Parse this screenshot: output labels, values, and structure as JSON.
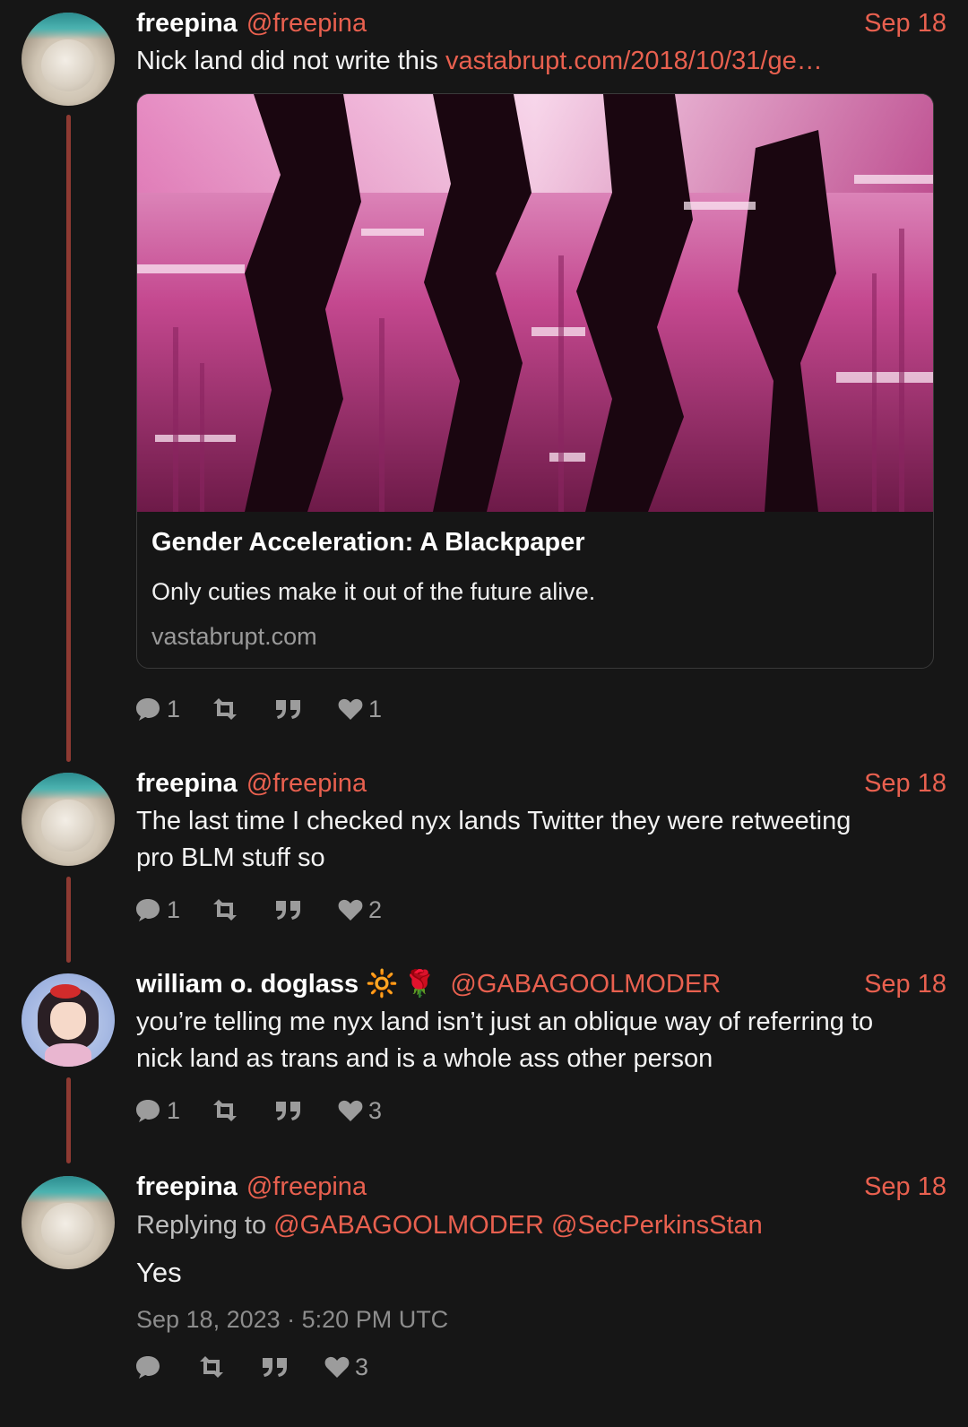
{
  "tweets": [
    {
      "name": "freepina",
      "handle": "@freepina",
      "date": "Sep 18",
      "text_prefix": "Nick land did not write this ",
      "link": "vastabrupt.com/2018/10/31/ge…",
      "card": {
        "title": "Gender Acceleration: A Blackpaper",
        "description": "Only cuties make it out of the future alive.",
        "domain": "vastabrupt.com"
      },
      "actions": {
        "replies": "1",
        "retweets": "",
        "quotes": "",
        "likes": "1"
      }
    },
    {
      "name": "freepina",
      "handle": "@freepina",
      "date": "Sep 18",
      "text_line1": "The last time I checked nyx lands Twitter they were retweeting",
      "text_line2": "pro BLM stuff so",
      "actions": {
        "replies": "1",
        "retweets": "",
        "quotes": "",
        "likes": "2"
      }
    },
    {
      "name": "william o. doglass",
      "name_emoji1": "🔆",
      "name_emoji2": "🌹",
      "handle": "@GABAGOOLMODER",
      "date": "Sep 18",
      "text_line1": "you’re telling me nyx land isn’t just an oblique way of referring to",
      "text_line2": "nick land as trans and is a whole ass other person",
      "actions": {
        "replies": "1",
        "retweets": "",
        "quotes": "",
        "likes": "3"
      }
    },
    {
      "name": "freepina",
      "handle": "@freepina",
      "date": "Sep 18",
      "replying_label": "Replying to",
      "replying_to1": "@GABAGOOLMODER",
      "replying_to2": "@SecPerkinsStan",
      "text": "Yes",
      "timestamp": "Sep 18, 2023 · 5:20 PM UTC",
      "actions": {
        "replies": "",
        "retweets": "",
        "quotes": "",
        "likes": "3"
      }
    }
  ],
  "icons": {
    "reply": "speech-bubble-icon",
    "retweet": "retweet-icon",
    "quote": "quote-icon",
    "like": "heart-icon"
  },
  "colors": {
    "background": "#161616",
    "accent": "#e8604f",
    "thread_line": "#8e3a32",
    "muted": "#9c9c9c"
  }
}
